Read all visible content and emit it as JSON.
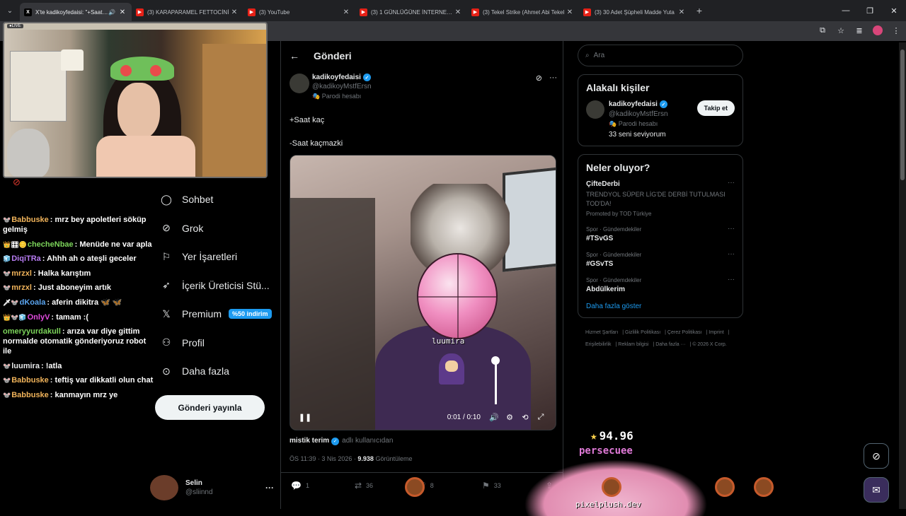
{
  "browser": {
    "tabs": [
      {
        "title": "X'te kadikoyfedaisi: \"+Saat kaç",
        "type": "x",
        "active": true
      },
      {
        "title": "(3) KARAPARAMEL FETTOCİNİ",
        "type": "yt",
        "active": false
      },
      {
        "title": "(3) YouTube",
        "type": "yt",
        "active": false
      },
      {
        "title": "(3) 1 GÜNLÜĞÜNE İNTERNETTE",
        "type": "yt",
        "active": false
      },
      {
        "title": "(3) Tekel Strike (Ahmet Abi Tekel",
        "type": "yt",
        "active": false
      },
      {
        "title": "(3) 30 Adet Şüpheli Madde Yuta",
        "type": "yt",
        "active": false
      }
    ]
  },
  "overlay": {
    "chat": [
      {
        "user": "Babbuske",
        "badges": "🐭",
        "color": "#f0b35a",
        "text": "mrz bey apoletleri söküp gelmiş"
      },
      {
        "user": "checheNbae",
        "badges": "👑🎛🪙",
        "color": "#7cd45a",
        "text": "Menüde ne var apla"
      },
      {
        "user": "DiqiTRa",
        "badges": "🧊",
        "color": "#b77cf2",
        "text": "Ahhh ah o ateşli geceler"
      },
      {
        "user": "mrzxl",
        "badges": "🐭",
        "color": "#f0b35a",
        "text": "Halka karıştım"
      },
      {
        "user": "mrzxl",
        "badges": "🐭",
        "color": "#f0b35a",
        "text": "Just aboneyim artık"
      },
      {
        "user": "dKoala",
        "badges": "🗡🐭",
        "color": "#5aa5f0",
        "text": "aferin dikitra 🦋 🦋"
      },
      {
        "user": "OnlyV",
        "badges": "👑🐭🧊",
        "color": "#e24be0",
        "text": "tamam :("
      },
      {
        "user": "omeryyurdakull",
        "badges": "",
        "color": "#7cd45a",
        "text": "arıza var diye gittim normalde otomatik gönderiyoruz robot ile"
      },
      {
        "user": "luumira",
        "badges": "🐭",
        "color": "#e7e9ea",
        "text": "!atla"
      },
      {
        "user": "Babbuske",
        "badges": "🐭",
        "color": "#f0b35a",
        "text": "teftiş var dikkatli olun chat"
      },
      {
        "user": "Babbuske",
        "badges": "🐭",
        "color": "#f0b35a",
        "text": "kanmayın mrz ye"
      }
    ],
    "score": "94.96",
    "player_name": "persecuee",
    "site": "pixelplush.dev",
    "video_overlay_name": "luumira"
  },
  "nav": {
    "items": [
      {
        "label": "Sohbet",
        "icon": "chat-icon"
      },
      {
        "label": "Grok",
        "icon": "grok-icon"
      },
      {
        "label": "Yer İşaretleri",
        "icon": "bookmark-icon"
      },
      {
        "label": "İçerik Üreticisi Stü...",
        "icon": "rocket-icon"
      },
      {
        "label": "Premium",
        "icon": "x-logo-icon"
      },
      {
        "label": "Profil",
        "icon": "profile-icon"
      },
      {
        "label": "Daha fazla",
        "icon": "more-icon"
      }
    ],
    "premium_badge": "%50 indirim",
    "post_button": "Gönderi yayınla",
    "account": {
      "name": "Selin",
      "handle": "@sliinnd"
    }
  },
  "post": {
    "header": "Gönderi",
    "author": {
      "name": "kadikoyfedaisi",
      "handle": "@kadikoyMstfErsn",
      "parody": "Parodi hesabı"
    },
    "line1": "+Saat kaç",
    "line2": "-Saat kaçmazki",
    "video_time": "0:01 / 0:10",
    "volume_pct": 100,
    "video_meta_name": "mistik terim",
    "video_meta_sub": "adlı kullanıcıdan",
    "date": "ÖS 11:39 · 3 Nis 2026 ·",
    "views": "9.938",
    "views_label": "Görüntüleme",
    "replies": "1",
    "reposts": "36",
    "likes": "8",
    "bookmarks": "33"
  },
  "sidebar": {
    "search_placeholder": "Ara",
    "relevant_title": "Alakalı kişiler",
    "relevant": {
      "name": "kadikoyfedaisi",
      "handle": "@kadikoyMstfErsn",
      "parody": "Parodi hesabı",
      "likes": "33 seni seviyorum",
      "follow": "Takip et"
    },
    "trends_title": "Neler oluyor?",
    "trends": [
      {
        "category": "",
        "title": "ÇifteDerbi",
        "desc": "TRENDYOL SÜPER LİG'DE DERBİ TUTULMASI TOD'DA!",
        "promo": "Promoted by TOD Türkiye"
      },
      {
        "category": "Spor · Gündemdekiler",
        "title": "#TSvGS",
        "desc": "",
        "promo": ""
      },
      {
        "category": "Spor · Gündemdekiler",
        "title": "#GSvTS",
        "desc": "",
        "promo": ""
      },
      {
        "category": "Spor · Gündemdekiler",
        "title": "Abdülkerim",
        "desc": "",
        "promo": ""
      }
    ],
    "show_more": "Daha fazla göster",
    "footer": [
      "Hizmet Şartları",
      "Gizlilik Politikası",
      "Çerez Politikası",
      "Imprint",
      "Erişilebilirlik",
      "Reklam bilgisi",
      "Daha fazla ···",
      "© 2026 X Corp."
    ]
  }
}
